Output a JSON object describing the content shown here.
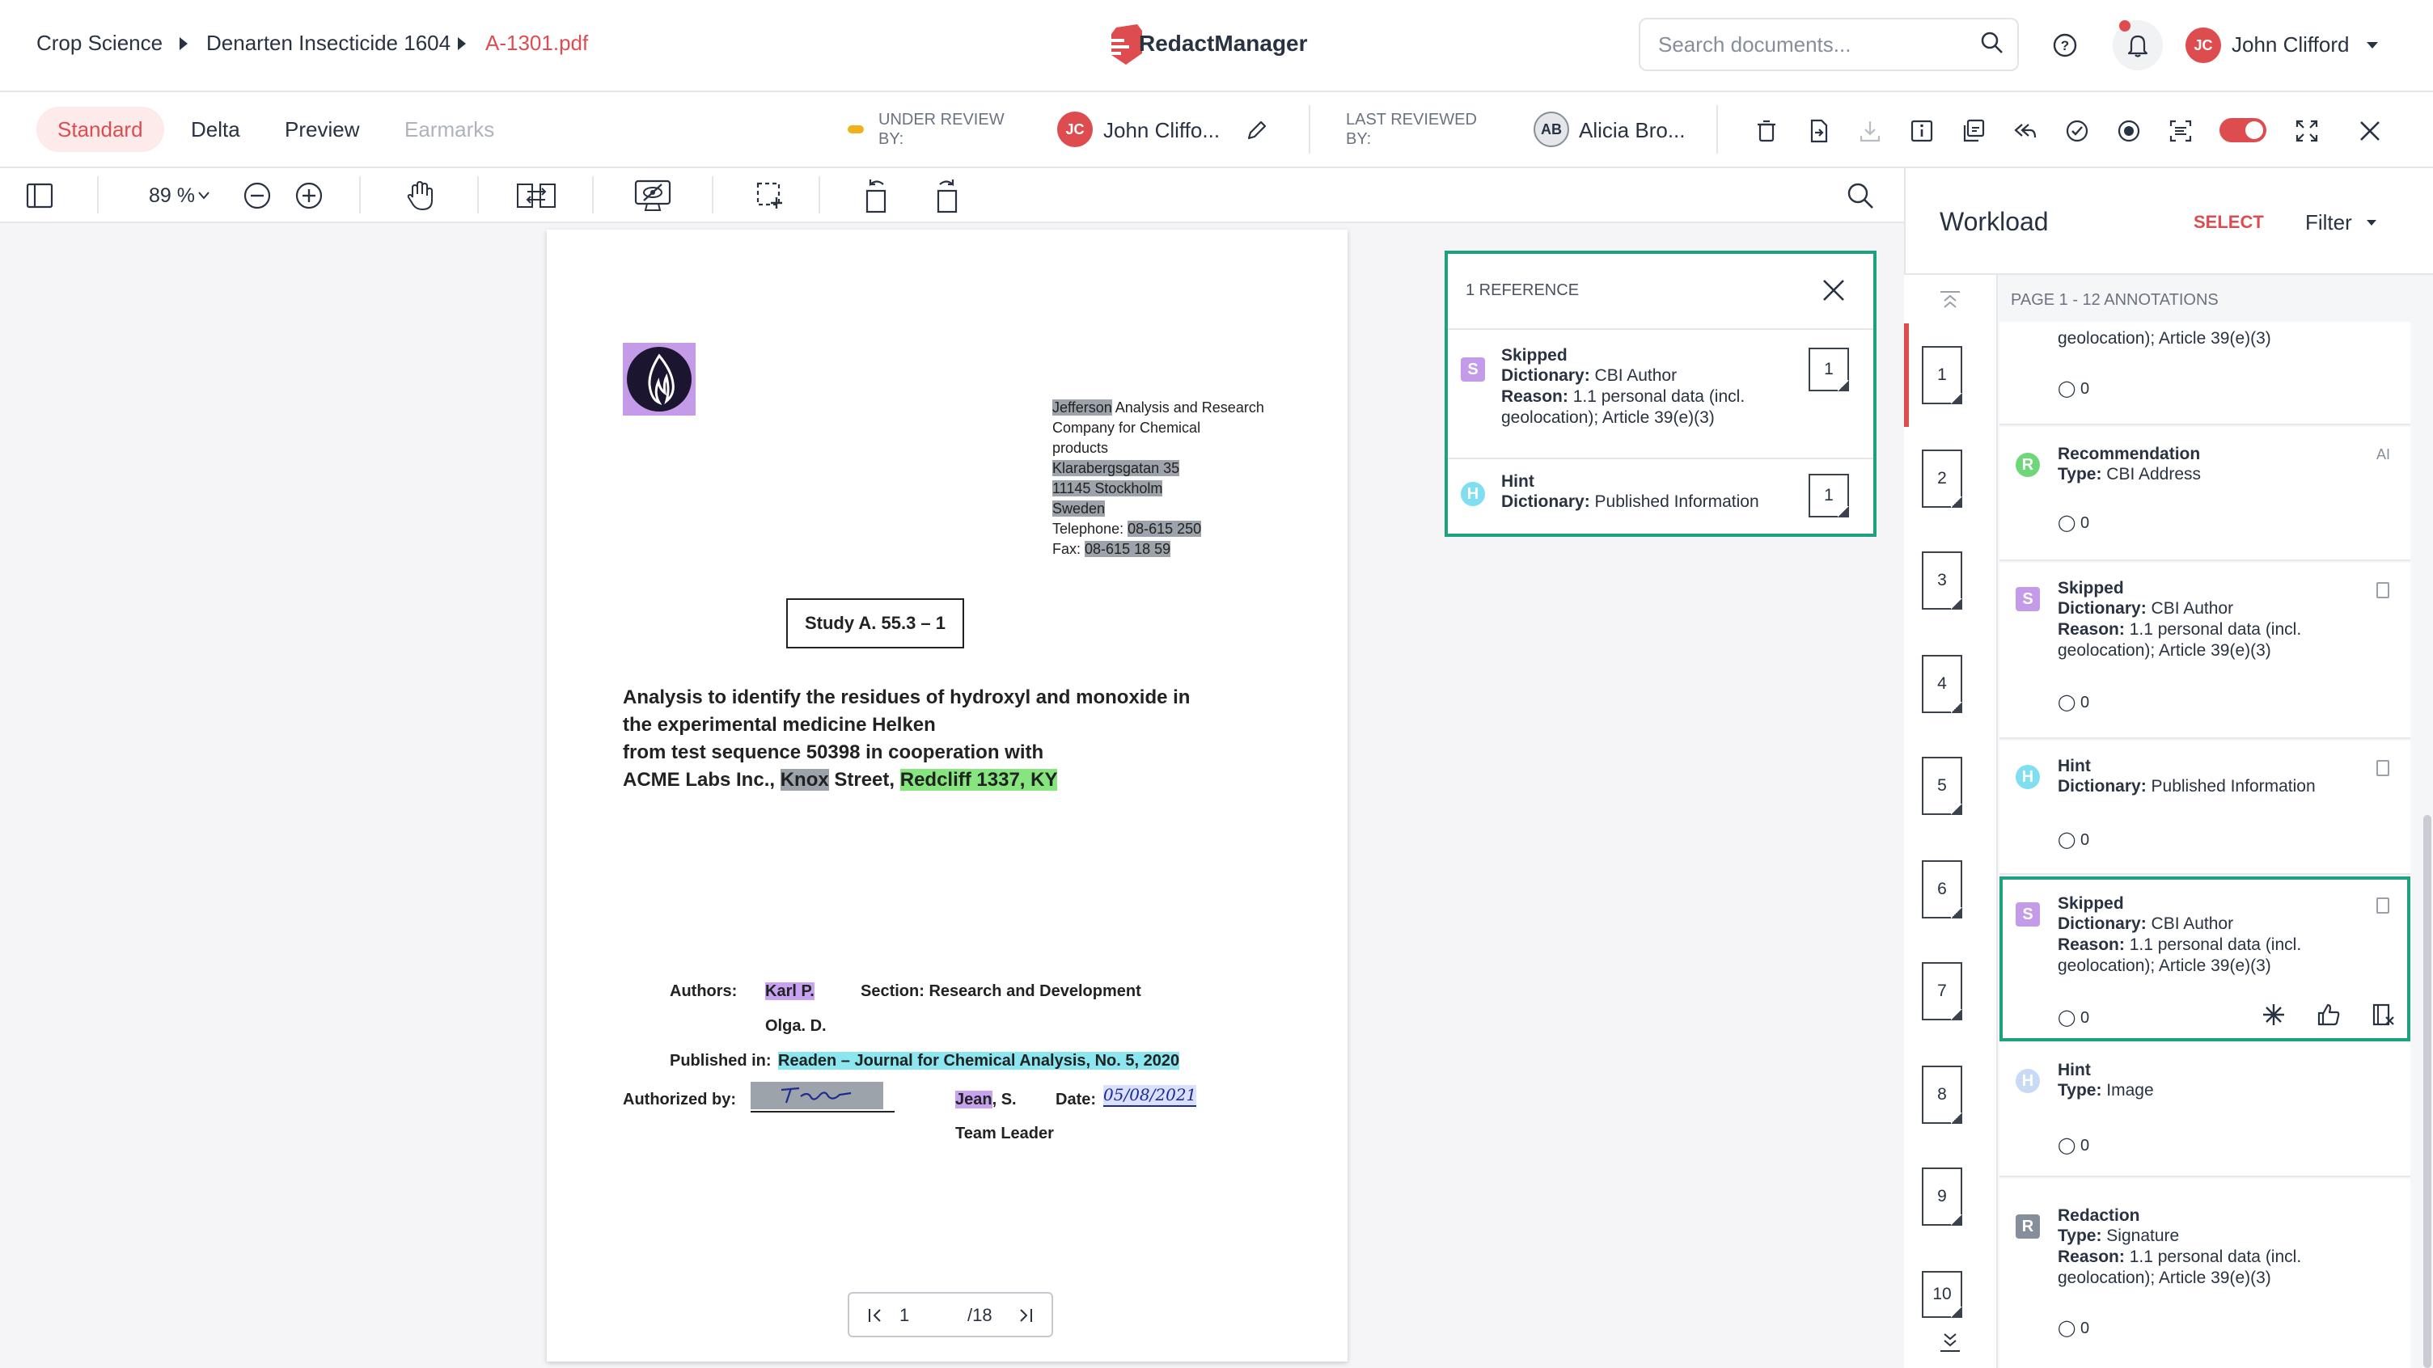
{
  "header": {
    "breadcrumb": [
      "Crop Science",
      "Denarten Insecticide 1604",
      "A-1301.pdf"
    ],
    "app_name": "RedactManager",
    "search_placeholder": "Search documents...",
    "user": {
      "initials": "JC",
      "name": "John Clifford"
    },
    "brand_color": "#dd4d50"
  },
  "toolbar": {
    "view_tabs": [
      "Standard",
      "Delta",
      "Preview",
      "Earmarks"
    ],
    "active_tab": "Standard",
    "under_review_label": [
      "UNDER REVIEW",
      "BY:"
    ],
    "reviewer": {
      "initials": "JC",
      "name": "John Cliffo..."
    },
    "last_reviewed_label": [
      "LAST REVIEWED",
      "BY:"
    ],
    "last_reviewer": {
      "initials": "AB",
      "name": "Alicia Bro..."
    }
  },
  "viewer": {
    "zoom": "89 %",
    "current_page": "1",
    "total_pages": "/18"
  },
  "document": {
    "address": {
      "company_name": "Jefferson",
      "company_rest": "Analysis and Research",
      "company_line2": "Company for Chemical",
      "company_line3": "products",
      "street": "Klarabergsgatan 35",
      "postal": "11145 Stockholm",
      "country": "Sweden",
      "telephone_label": "Telephone:",
      "telephone": "08-615 250",
      "fax_label": "Fax:",
      "fax": "08-615 18 59"
    },
    "study_box": "Study A. 55.3 – 1",
    "title_lines": [
      "Analysis to identify the residues of hydroxyl and monoxide in",
      "the experimental medicine Helken",
      "from test sequence 50398 in cooperation with"
    ],
    "title_line4": {
      "prefix": "ACME Labs Inc., ",
      "knox": "Knox",
      "middle": " Street, ",
      "redcliff": "Redcliff 1337, KY"
    },
    "authors_label": "Authors:",
    "author1": "Karl P.",
    "section": "Section: Research and Development",
    "author2": "Olga. D.",
    "published_label": "Published in:",
    "published_value": "Readen – Journal for Chemical Analysis, No. 5, 2020",
    "authorized_label": "Authorized by:",
    "jean": "Jean",
    "jean_rest": ", S.",
    "date_label": "Date:",
    "date_value": "05/08/2021",
    "team_leader": "Team Leader"
  },
  "reference_popup": {
    "title": "1 REFERENCE",
    "items": [
      {
        "badge": "S",
        "type": "Skipped",
        "lines": [
          [
            "Dictionary:",
            " CBI Author"
          ],
          [
            "Reason:",
            " 1.1 personal data (incl."
          ],
          [
            "",
            "geolocation); Article 39(e)(3)"
          ]
        ],
        "page": "1"
      },
      {
        "badge": "H",
        "type": "Hint",
        "lines": [
          [
            "Dictionary:",
            " Published Information"
          ]
        ],
        "page": "1"
      }
    ]
  },
  "workload": {
    "title": "Workload",
    "select_label": "SELECT",
    "filter_label": "Filter",
    "page_header": "PAGE 1 - 12 ANNOTATIONS",
    "page_numbers": [
      "1",
      "2",
      "3",
      "4",
      "5",
      "6",
      "7",
      "8",
      "9",
      "10"
    ],
    "top_partial_text": "geolocation); Article 39(e)(3)",
    "top_partial_comments": "0",
    "cards": [
      {
        "badge": "R",
        "type": "Recommendation",
        "lines": [
          [
            "Type:",
            " CBI Address"
          ]
        ],
        "comments": "0",
        "flag": "AI"
      },
      {
        "badge": "S",
        "type": "Skipped",
        "lines": [
          [
            "Dictionary:",
            " CBI Author"
          ],
          [
            "Reason:",
            " 1.1 personal data (incl."
          ],
          [
            "",
            "geolocation); Article 39(e)(3)"
          ]
        ],
        "comments": "0"
      },
      {
        "badge": "H",
        "type": "Hint",
        "lines": [
          [
            "Dictionary:",
            " Published Information"
          ]
        ],
        "comments": "0"
      },
      {
        "badge": "S",
        "type": "Skipped",
        "lines": [
          [
            "Dictionary:",
            " CBI Author"
          ],
          [
            "Reason:",
            " 1.1 personal data (incl."
          ],
          [
            "",
            "geolocation); Article 39(e)(3)"
          ]
        ],
        "comments": "0"
      },
      {
        "badge": "H",
        "type": "Hint",
        "lines": [
          [
            "Type:",
            " Image"
          ]
        ],
        "comments": "0"
      },
      {
        "badge": "R",
        "type": "Redaction",
        "lines": [
          [
            "Type:",
            " Signature"
          ],
          [
            "Reason:",
            " 1.1 personal data (incl."
          ],
          [
            "",
            "geolocation); Article 39(e)(3)"
          ]
        ],
        "comments": "0"
      }
    ]
  },
  "colors": {
    "skipped": "#c39be8",
    "hint": "#7fdff0",
    "recommendation": "#6fd67a",
    "redaction": "#868e9b",
    "highlight_border": "#1fa07e",
    "toggle": "#dd4d50"
  }
}
